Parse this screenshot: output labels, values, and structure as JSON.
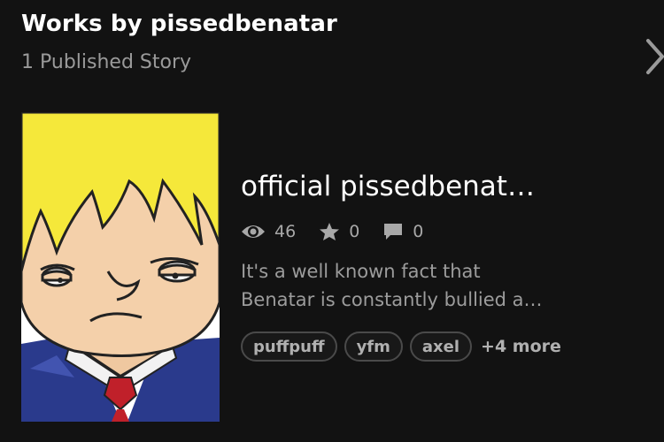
{
  "header": {
    "title": "Works by pissedbenatar",
    "subtitle": "1 Published Story"
  },
  "icons": {
    "navigate": "chevron-right-icon",
    "reads": "eye-icon",
    "votes": "star-icon",
    "comments": "comment-icon"
  },
  "story": {
    "title": "official pissedbenat…",
    "stats": {
      "reads": "46",
      "votes": "0",
      "comments": "0"
    },
    "description_lines": [
      "It's a well known fact that",
      "Benatar is constantly bullied a…"
    ],
    "tags": [
      "puffpuff",
      "yfm",
      "axel"
    ],
    "more_tags": "+4 more"
  },
  "colors": {
    "background": "#121212",
    "title_text": "#ffffff",
    "muted_text": "#9a9a9a",
    "tag_border": "#4a4a4a"
  }
}
